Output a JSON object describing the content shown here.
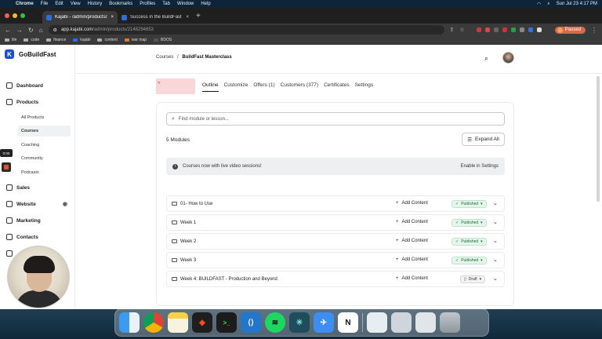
{
  "menubar": {
    "app": "Chrome",
    "items": [
      "File",
      "Edit",
      "View",
      "History",
      "Bookmarks",
      "Profiles",
      "Tab",
      "Window",
      "Help"
    ],
    "datetime": "Sun Jul 23  4:17 PM"
  },
  "browser": {
    "tabs": [
      {
        "title": "Kajabi - /admin/products/2148",
        "active": true
      },
      {
        "title": "Success in the BuildFast - Go",
        "active": false
      }
    ],
    "url_host": "app.kajabi.com",
    "url_path": "/admin/products/2148294653",
    "profile_label": "Paused",
    "profile_initial": "P",
    "bookmarks": [
      "life",
      "code",
      "finance",
      "kajabi",
      "content",
      "war map",
      "BDOS"
    ]
  },
  "sidebar": {
    "brand": "GoBuildFast",
    "brand_initial": "K",
    "items": {
      "dashboard": "Dashboard",
      "products": "Products",
      "sales": "Sales",
      "website": "Website",
      "marketing": "Marketing",
      "contacts": "Contacts"
    },
    "subitems": [
      "All Products",
      "Courses",
      "Coaching",
      "Community",
      "Podcasts"
    ],
    "active_subitem": "Courses",
    "timer": "0:00"
  },
  "main": {
    "breadcrumb_root": "Courses",
    "breadcrumb_sep": "/",
    "breadcrumb_current": "BuildFast Masterclass",
    "thumb_text": "ry",
    "tabs": [
      "Outline",
      "Customize",
      "Offers (1)",
      "Customers (377)",
      "Certificates",
      "Settings"
    ],
    "active_tab": "Outline",
    "search_placeholder": "Find module or lesson...",
    "modules_count": "5 Modules",
    "expand_all": "Expand All",
    "banner_text": "Courses now with live video sessions!",
    "banner_link": "Enable in Settings",
    "add_content_label": "Add Content",
    "modules": [
      {
        "title": "01- How to Use",
        "status": "Published"
      },
      {
        "title": "Week 1",
        "status": "Published"
      },
      {
        "title": "Week 2",
        "status": "Published"
      },
      {
        "title": "Week 3",
        "status": "Published"
      },
      {
        "title": "Week 4: BUILDFAST - Production and Beyond",
        "status": "Draft"
      }
    ]
  },
  "dock": {
    "apps": [
      "finder-icon",
      "chrome-icon",
      "notes-icon",
      "figma-icon",
      "terminal-icon",
      "vscode-icon",
      "spotify-icon",
      "perplexity-icon",
      "testflight-icon",
      "notion-icon",
      "preview-icon",
      "window-icon",
      "window-icon-2",
      "trash-icon"
    ]
  },
  "colors": {
    "brand": "#1c4bd6",
    "published_bg": "#e4f5ea",
    "published_text": "#1d6b3a",
    "paused": "#d9674a"
  }
}
